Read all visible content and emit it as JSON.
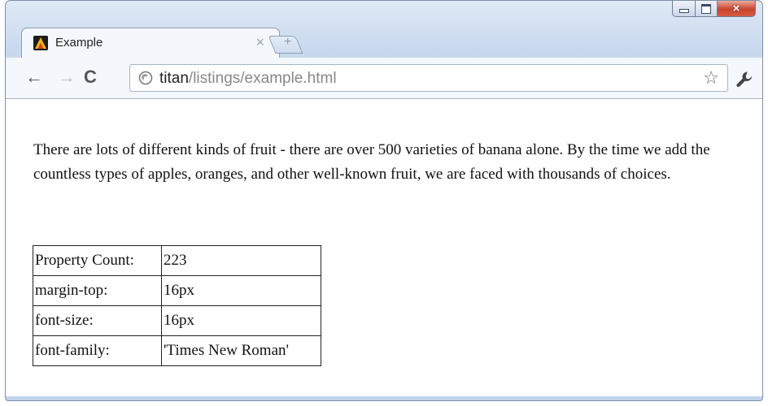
{
  "window": {
    "controls": {
      "minimize": "minimize",
      "maximize": "maximize",
      "close": "×"
    }
  },
  "tab": {
    "title": "Example",
    "close_label": "×",
    "favicon": "titan-icon"
  },
  "toolbar": {
    "back_label": "←",
    "forward_label": "→",
    "reload_label": "C",
    "url_host": "titan",
    "url_path": "/listings/example.html",
    "star_label": "☆"
  },
  "content": {
    "paragraph": "There are lots of different kinds of fruit - there are over 500 varieties of banana alone. By the time we add the countless types of apples, oranges, and other well-known fruit, we are faced with thousands of choices.",
    "table": [
      {
        "key": "Property Count:",
        "value": "223"
      },
      {
        "key": "margin-top:",
        "value": "16px"
      },
      {
        "key": "font-size:",
        "value": "16px"
      },
      {
        "key": "font-family:",
        "value": "'Times New Roman'"
      }
    ]
  },
  "colors": {
    "frame": "#c9d9ee",
    "close_button": "#c7432b"
  }
}
